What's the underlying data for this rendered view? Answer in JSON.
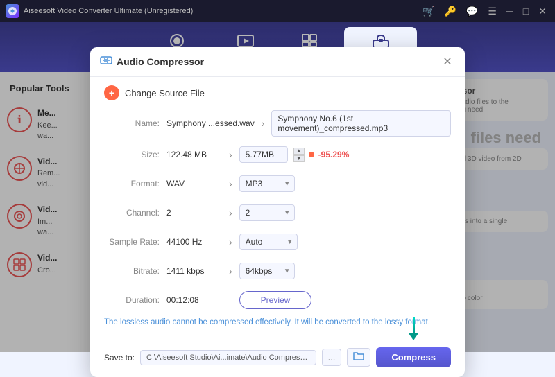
{
  "app": {
    "title": "Aiseesoft Video Converter Ultimate (Unregistered)"
  },
  "titlebar": {
    "icons": [
      "cart-icon",
      "key-icon",
      "chat-icon",
      "menu-icon",
      "minimize-icon",
      "maximize-icon",
      "close-icon"
    ]
  },
  "navbar": {
    "tabs": [
      {
        "id": "converter",
        "label": "Converter",
        "active": false
      },
      {
        "id": "mv",
        "label": "MV",
        "active": false
      },
      {
        "id": "collage",
        "label": "Collage",
        "active": false
      },
      {
        "id": "toolbox",
        "label": "Toolbox",
        "active": true
      }
    ]
  },
  "sidebar": {
    "title": "Popular Tools",
    "items": [
      {
        "id": "media-info",
        "label": "Me...",
        "desc": "Kee...\nwa..."
      },
      {
        "id": "video-enhance",
        "label": "Vid...",
        "desc": "Rem...\nvid..."
      },
      {
        "id": "video-watermark",
        "label": "Vid...",
        "desc": "Im...\nwa..."
      },
      {
        "id": "video-collage",
        "label": "Vid...",
        "desc": "Cro..."
      }
    ]
  },
  "background_text": {
    "right_panel": "files need"
  },
  "dialog": {
    "title": "Audio Compressor",
    "change_source": "Change Source File",
    "fields": {
      "name_label": "Name:",
      "name_input": "Symphony ...essed.wav",
      "name_output": "Symphony No.6 (1st movement)_compressed.mp3",
      "size_label": "Size:",
      "size_input": "122.48 MB",
      "size_output": "5.77MB",
      "size_percent": "-95.29%",
      "format_label": "Format:",
      "format_input": "WAV",
      "format_output": "MP3",
      "channel_label": "Channel:",
      "channel_input": "2",
      "channel_output": "2",
      "samplerate_label": "Sample Rate:",
      "samplerate_input": "44100 Hz",
      "samplerate_output": "Auto",
      "bitrate_label": "Bitrate:",
      "bitrate_input": "1411 kbps",
      "bitrate_output": "64kbps",
      "duration_label": "Duration:",
      "duration_input": "00:12:08",
      "preview_btn": "Preview"
    },
    "warning": "The lossless audio cannot be compressed effectively. It will be converted to the lossy format.",
    "footer": {
      "save_label": "Save to:",
      "save_path": "C:\\Aiseesoft Studio\\Ai...imate\\Audio Compressed",
      "dots_btn": "...",
      "compress_btn": "Compress"
    }
  }
}
